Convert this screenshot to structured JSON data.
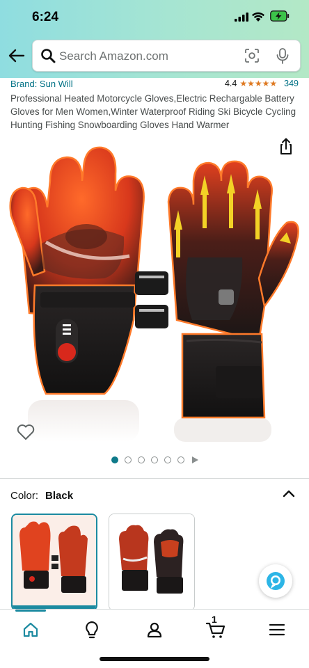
{
  "status_bar": {
    "time": "6:24"
  },
  "search": {
    "placeholder": "Search Amazon.com"
  },
  "product": {
    "brand": "Brand: Sun Will",
    "rating_value": "4.4",
    "rating_stars": "★★★★★",
    "rating_count": "349",
    "title": "Professional Heated Motorcycle Gloves,Electric Rechargable Battery Gloves for Men Women,Winter Waterproof Riding Ski Bicycle Cycling Hunting Fishing Snowboarding Gloves Hand Warmer"
  },
  "gallery": {
    "dot_count": 6,
    "active_index": 0
  },
  "color_selector": {
    "label": "Color:",
    "selected": "Black"
  },
  "bottom_nav": {
    "cart_count": "1"
  },
  "colors": {
    "accent": "#1b8aa0",
    "link": "#007185",
    "star": "#de7921"
  }
}
